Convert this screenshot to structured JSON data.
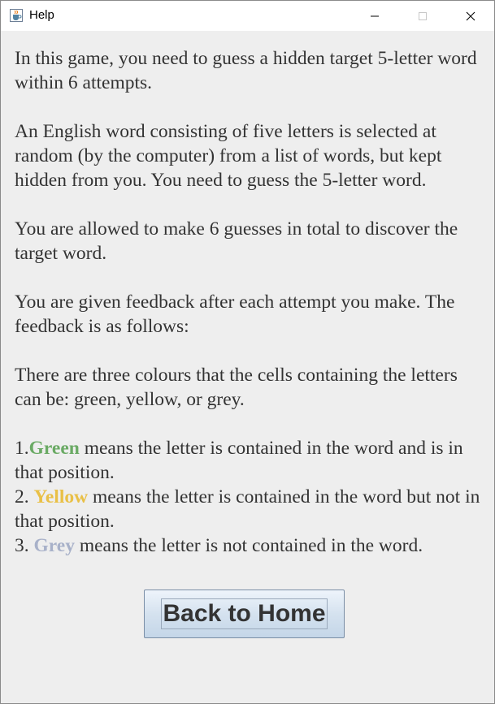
{
  "window": {
    "title": "Help"
  },
  "help": {
    "p1": "In this game, you need to guess a hidden target 5-letter word within 6 attempts.",
    "p2": "An English word consisting of five letters is selected at random (by the computer) from a list of words, but kept hidden from you. You need to guess the 5-letter word.",
    "p3": "You are allowed to make 6 guesses in total to discover the target word.",
    "p4": "You are given feedback after each attempt you make. The feedback is as follows:",
    "p5": "There are three colours that the cells containing the letters can be: green, yellow, or grey.",
    "rules": [
      {
        "prefix": "1.",
        "color_word": "Green",
        "text": " means the letter is contained in the word and is in that position."
      },
      {
        "prefix": "2. ",
        "color_word": "Yellow",
        "text": " means the letter is contained in the word but not in that position."
      },
      {
        "prefix": "3. ",
        "color_word": "Grey",
        "text": " means the letter is not contained in the word."
      }
    ]
  },
  "button": {
    "label": "Back to Home"
  },
  "colors": {
    "green": "#6aaa64",
    "yellow": "#e9c046",
    "grey": "#a8b1c9",
    "text": "#333333",
    "background": "#eeeeee"
  },
  "icons": {
    "app": "java-cup-icon",
    "minimize": "minimize-icon",
    "maximize": "maximize-icon",
    "close": "close-icon"
  }
}
